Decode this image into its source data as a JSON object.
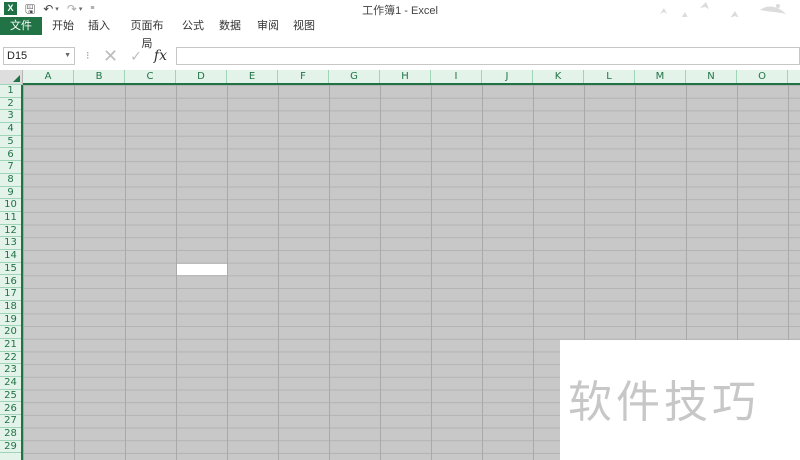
{
  "app": {
    "window_title": "工作簿1 - Excel",
    "logo_icon": "excel-logo-icon",
    "quick_access": [
      {
        "name": "save-icon",
        "glyph": "🖫"
      },
      {
        "name": "undo-icon",
        "glyph": "↶"
      },
      {
        "name": "redo-icon",
        "glyph": "↷"
      }
    ],
    "accent_color": "#217346"
  },
  "ribbon": {
    "tabs": [
      {
        "label": "文件"
      },
      {
        "label": "开始"
      },
      {
        "label": "插入"
      },
      {
        "label": "页面布局"
      },
      {
        "label": "公式"
      },
      {
        "label": "数据"
      },
      {
        "label": "审阅"
      },
      {
        "label": "视图"
      }
    ]
  },
  "formula_bar": {
    "name_box": "D15",
    "cancel_glyph": "✕",
    "enter_glyph": "✓",
    "fx_label": "fx",
    "formula_value": ""
  },
  "sheet": {
    "columns": [
      "A",
      "B",
      "C",
      "D",
      "E",
      "F",
      "G",
      "H",
      "I",
      "J",
      "K",
      "L",
      "M",
      "N",
      "O"
    ],
    "rows": [
      "1",
      "2",
      "3",
      "4",
      "5",
      "6",
      "7",
      "8",
      "9",
      "10",
      "11",
      "12",
      "13",
      "14",
      "15",
      "16",
      "17",
      "18",
      "19",
      "20",
      "21",
      "22",
      "23",
      "24",
      "25",
      "26",
      "27",
      "28",
      "29"
    ],
    "active_cell": {
      "column": "D",
      "row": 15
    },
    "fill_color": "#c8c8c8"
  },
  "watermark": {
    "text": "软件技巧"
  }
}
